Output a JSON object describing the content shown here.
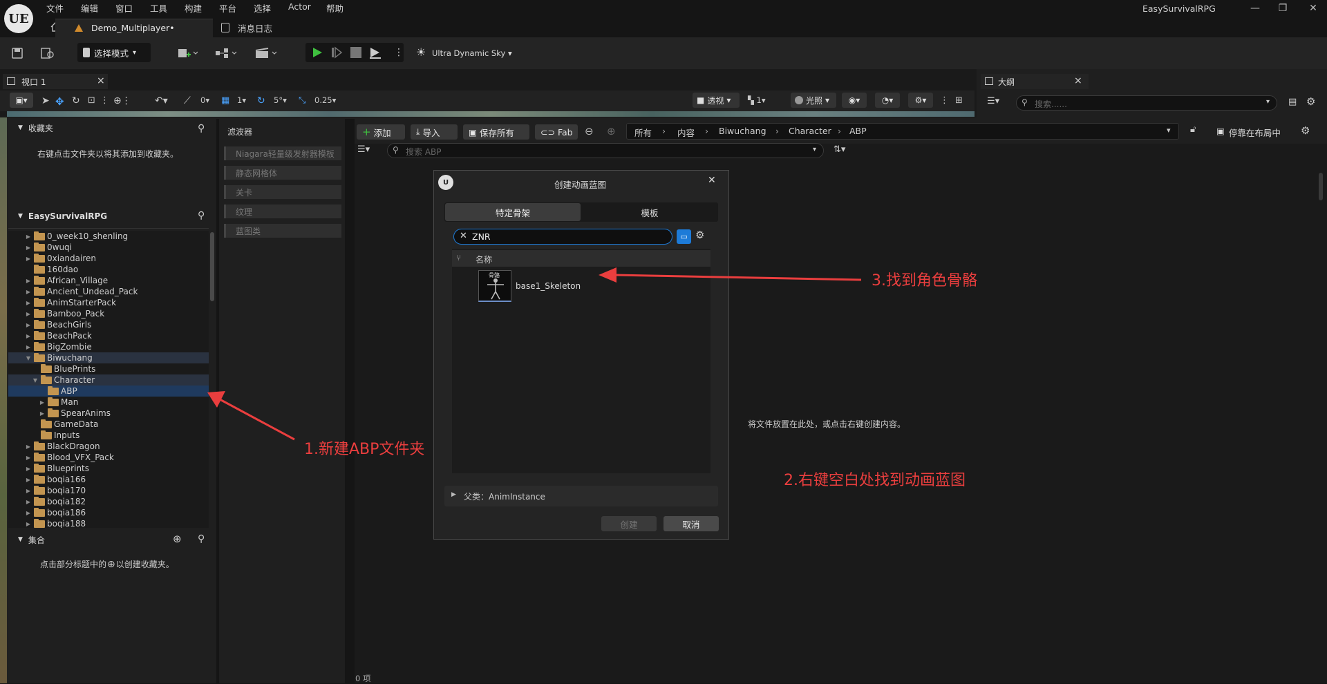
{
  "title_bar": {
    "logo": "UE",
    "menus": [
      "文件",
      "编辑",
      "窗口",
      "工具",
      "构建",
      "平台",
      "选择",
      "Actor",
      "帮助"
    ],
    "project_tab": "Demo_Multiplayer•",
    "message_log_tab": "消息日志",
    "project_name": "EasySurvivalRPG",
    "window_controls": [
      "—",
      "❐",
      "✕"
    ]
  },
  "toolbar": {
    "mode": "选择模式",
    "sky": "Ultra Dynamic Sky"
  },
  "viewport": {
    "tab_label": "视口 1",
    "close": "×",
    "snap_angle_value": "0",
    "grid_value": "1",
    "rotation_value": "5°",
    "scale_value": "0.25",
    "perspective": "透视",
    "camera_speed": "1",
    "lighting": "光照"
  },
  "outline": {
    "tab_label": "大纲",
    "close": "×",
    "search_placeholder": "搜索......"
  },
  "favorites": {
    "header": "收藏夹",
    "hint": "右键点击文件夹以将其添加到收藏夹。"
  },
  "project": {
    "header": "EasySurvivalRPG",
    "tree": [
      {
        "label": "0_week10_shenling",
        "depth": 0,
        "expandable": true
      },
      {
        "label": "0wuqi",
        "depth": 0,
        "expandable": true
      },
      {
        "label": "0xiandairen",
        "depth": 0,
        "expandable": true
      },
      {
        "label": "160dao",
        "depth": 0,
        "expandable": false
      },
      {
        "label": "African_Village",
        "depth": 0,
        "expandable": true
      },
      {
        "label": "Ancient_Undead_Pack",
        "depth": 0,
        "expandable": true
      },
      {
        "label": "AnimStarterPack",
        "depth": 0,
        "expandable": true
      },
      {
        "label": "Bamboo_Pack",
        "depth": 0,
        "expandable": true
      },
      {
        "label": "BeachGirls",
        "depth": 0,
        "expandable": true
      },
      {
        "label": "BeachPack",
        "depth": 0,
        "expandable": true
      },
      {
        "label": "BigZombie",
        "depth": 0,
        "expandable": true
      },
      {
        "label": "Biwuchang",
        "depth": 0,
        "expandable": true,
        "open": true,
        "state": "hl"
      },
      {
        "label": "BluePrints",
        "depth": 1,
        "expandable": false
      },
      {
        "label": "Character",
        "depth": 1,
        "expandable": true,
        "open": true,
        "state": "hl"
      },
      {
        "label": "ABP",
        "depth": 2,
        "expandable": false,
        "state": "sel"
      },
      {
        "label": "Man",
        "depth": 2,
        "expandable": true
      },
      {
        "label": "SpearAnims",
        "depth": 2,
        "expandable": true
      },
      {
        "label": "GameData",
        "depth": 1,
        "expandable": false
      },
      {
        "label": "Inputs",
        "depth": 1,
        "expandable": false
      },
      {
        "label": "BlackDragon",
        "depth": 0,
        "expandable": true
      },
      {
        "label": "Blood_VFX_Pack",
        "depth": 0,
        "expandable": true
      },
      {
        "label": "Blueprints",
        "depth": 0,
        "expandable": true
      },
      {
        "label": "boqia166",
        "depth": 0,
        "expandable": true
      },
      {
        "label": "boqia170",
        "depth": 0,
        "expandable": true
      },
      {
        "label": "boqia182",
        "depth": 0,
        "expandable": true
      },
      {
        "label": "boqia186",
        "depth": 0,
        "expandable": true
      },
      {
        "label": "boqia188",
        "depth": 0,
        "expandable": true
      }
    ]
  },
  "collections": {
    "header": "集合",
    "hint_before": "点击部分标题中的",
    "hint_after": "以创建收藏夹。"
  },
  "filters": {
    "header": "滤波器",
    "items": [
      "Niagara轻量级发射器模板",
      "静态网格体",
      "关卡",
      "纹理",
      "蓝图类"
    ]
  },
  "content": {
    "add": "添加",
    "import": "导入",
    "save_all": "保存所有",
    "fab": "Fab",
    "breadcrumb": [
      "所有",
      "内容",
      "Biwuchang",
      "Character",
      "ABP"
    ],
    "dock": "停靠在布局中",
    "search_placeholder": "搜索 ABP",
    "empty_hint": "将文件放置在此处，或点击右键创建内容。",
    "item_count": "0 项"
  },
  "dialog": {
    "title": "创建动画蓝图",
    "close": "✕",
    "tab_skeleton": "特定骨架",
    "tab_template": "模板",
    "search_value": "ZNR",
    "column_name": "名称",
    "thumb_label": "骨骼",
    "item": "base1_Skeleton",
    "parent": "父类：AnimInstance",
    "create": "创建",
    "cancel": "取消"
  },
  "annotations": {
    "step1": "1.新建ABP文件夹",
    "step2": "2.右键空白处找到动画蓝图",
    "step3": "3.找到角色骨骼",
    "color": "#ea3e3e"
  }
}
